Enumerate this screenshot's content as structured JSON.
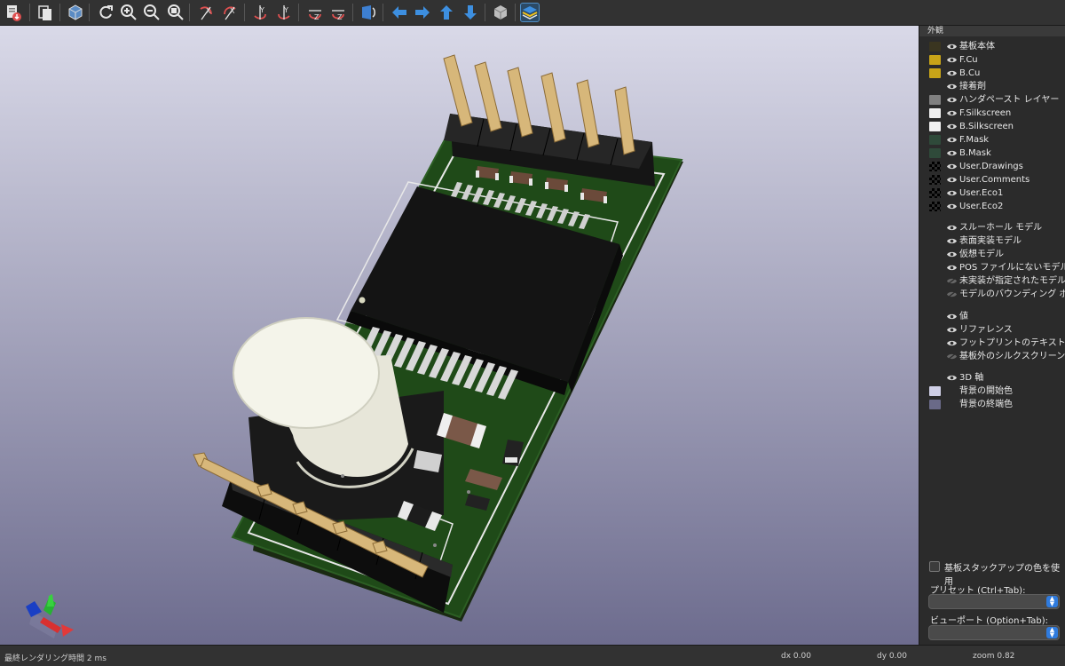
{
  "toolbar": {
    "buttons": [
      {
        "icon": "export-icon"
      },
      {
        "icon": "copy-icon"
      },
      {
        "icon": "raytrace-icon"
      },
      {
        "icon": "reload-icon"
      },
      {
        "icon": "zoom-in-icon"
      },
      {
        "icon": "zoom-out-icon"
      },
      {
        "icon": "zoom-fit-icon"
      },
      {
        "icon": "rotate-x-cw-icon"
      },
      {
        "icon": "rotate-x-ccw-icon"
      },
      {
        "icon": "rotate-y-cw-icon"
      },
      {
        "icon": "rotate-y-ccw-icon"
      },
      {
        "icon": "rotate-z-cw-icon"
      },
      {
        "icon": "rotate-z-ccw-icon"
      },
      {
        "icon": "flip-board-icon"
      },
      {
        "icon": "arrow-left-icon"
      },
      {
        "icon": "arrow-right-icon"
      },
      {
        "icon": "arrow-up-icon"
      },
      {
        "icon": "arrow-down-icon"
      },
      {
        "icon": "ortho-icon"
      },
      {
        "icon": "layers-manager-icon"
      }
    ]
  },
  "panel": {
    "title": "外観",
    "layers": [
      {
        "label": "基板本体",
        "color": "#3a3520",
        "eye": "on"
      },
      {
        "label": "F.Cu",
        "color": "#c8a418",
        "eye": "on"
      },
      {
        "label": "B.Cu",
        "color": "#c8a418",
        "eye": "on"
      },
      {
        "label": "接着剤",
        "color": "",
        "eye": "on"
      },
      {
        "label": "ハンダペースト レイヤー",
        "color": "#808080",
        "eye": "on"
      },
      {
        "label": "F.Silkscreen",
        "color": "#f0f0f0",
        "eye": "on"
      },
      {
        "label": "B.Silkscreen",
        "color": "#f0f0f0",
        "eye": "on"
      },
      {
        "label": "F.Mask",
        "color": "#2f4a3a",
        "eye": "on"
      },
      {
        "label": "B.Mask",
        "color": "#2f4a3a",
        "eye": "on"
      },
      {
        "label": "User.Drawings",
        "color": "checker",
        "eye": "on"
      },
      {
        "label": "User.Comments",
        "color": "checker",
        "eye": "on"
      },
      {
        "label": "User.Eco1",
        "color": "checker",
        "eye": "on"
      },
      {
        "label": "User.Eco2",
        "color": "checker",
        "eye": "on"
      }
    ],
    "models": [
      {
        "label": "スルーホール モデル",
        "eye": "on"
      },
      {
        "label": "表面実装モデル",
        "eye": "on"
      },
      {
        "label": "仮想モデル",
        "eye": "on"
      },
      {
        "label": "POS ファイルにないモデル",
        "eye": "on"
      },
      {
        "label": "未実装が指定されたモデル",
        "eye": "off"
      },
      {
        "label": "モデルのバウンディング ボックス",
        "eye": "off"
      }
    ],
    "texts": [
      {
        "label": "値",
        "eye": "on"
      },
      {
        "label": "リファレンス",
        "eye": "on"
      },
      {
        "label": "フットプリントのテキスト",
        "eye": "on"
      },
      {
        "label": "基板外のシルクスクリーン",
        "eye": "off"
      }
    ],
    "misc": [
      {
        "label": "3D 軸",
        "color": "",
        "eye": "on"
      },
      {
        "label": "背景の開始色",
        "color": "#cfcfe6",
        "eye": ""
      },
      {
        "label": "背景の終端色",
        "color": "#6a6a88",
        "eye": ""
      }
    ],
    "stackup_checkbox_label": "基板スタックアップの色を使用",
    "preset_label": "プリセット (Ctrl+Tab):",
    "preset_value": "",
    "viewport_label": "ビューポート (Option+Tab):",
    "viewport_value": ""
  },
  "status": {
    "render_time": "最終レンダリング時間 2 ms",
    "dx": "dx 0.00",
    "dy": "dy 0.00",
    "zoom": "zoom 0.82"
  }
}
